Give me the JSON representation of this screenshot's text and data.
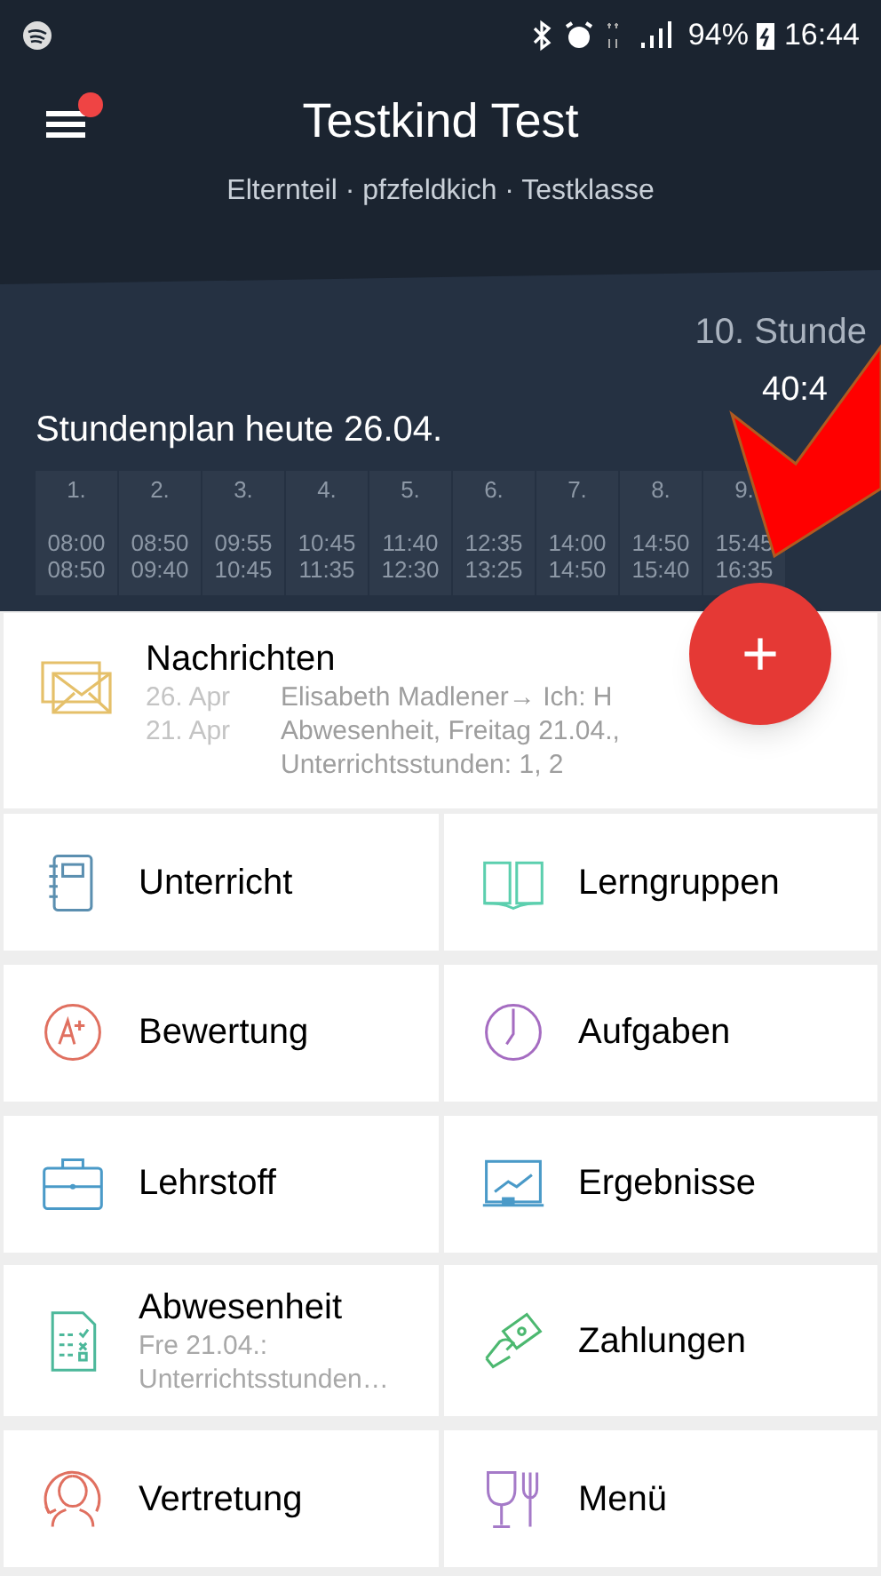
{
  "status_bar": {
    "battery": "94%",
    "time": "16:44"
  },
  "header": {
    "title": "Testkind Test",
    "subtitle": "Elternteil · pfzfeldkich · Testklasse",
    "menu_notification": true
  },
  "schedule": {
    "current_lesson": "10. Stunde",
    "countdown": "40:4",
    "title": "Stundenplan heute 26.04.",
    "lessons": [
      {
        "number": "1.",
        "start": "08:00",
        "end": "08:50"
      },
      {
        "number": "2.",
        "start": "08:50",
        "end": "09:40"
      },
      {
        "number": "3.",
        "start": "09:55",
        "end": "10:45"
      },
      {
        "number": "4.",
        "start": "10:45",
        "end": "11:35"
      },
      {
        "number": "5.",
        "start": "11:40",
        "end": "12:30"
      },
      {
        "number": "6.",
        "start": "12:35",
        "end": "13:25"
      },
      {
        "number": "7.",
        "start": "14:00",
        "end": "14:50"
      },
      {
        "number": "8.",
        "start": "14:50",
        "end": "15:40"
      },
      {
        "number": "9.",
        "start": "15:45",
        "end": "16:35"
      }
    ]
  },
  "fab": {
    "label": "+"
  },
  "messages": {
    "title": "Nachrichten",
    "entries": [
      {
        "date": "26. Apr",
        "text": "Elisabeth Madlener→ Ich: H"
      },
      {
        "date": "21. Apr",
        "text": "Abwesenheit, Freitag 21.04., Unterrichtsstunden: 1, 2"
      }
    ]
  },
  "tiles": [
    {
      "label": "Unterricht"
    },
    {
      "label": "Lerngruppen"
    },
    {
      "label": "Bewertung"
    },
    {
      "label": "Aufgaben"
    },
    {
      "label": "Lehrstoff"
    },
    {
      "label": "Ergebnisse"
    },
    {
      "label": "Abwesenheit",
      "details": [
        "Fre 21.04.:",
        "Unterrichtsstunden…"
      ]
    },
    {
      "label": "Zahlungen"
    },
    {
      "label": "Vertretung"
    },
    {
      "label": "Menü"
    }
  ]
}
